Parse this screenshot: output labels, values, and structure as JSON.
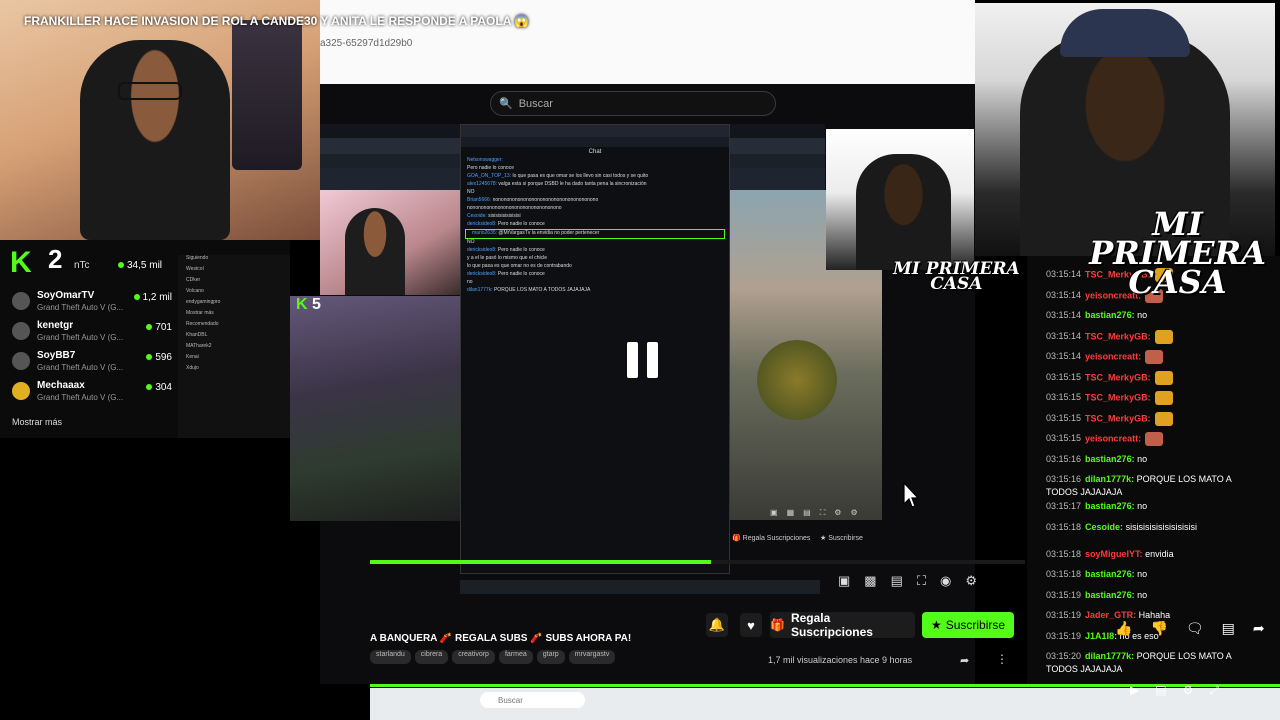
{
  "video": {
    "title": "FRANKILLER HACE INVASION DE ROL A CANDE30 Y ANITA LE RESPONDE A PAOLA 😱",
    "url_fragment": "a325-65297d1d29b0"
  },
  "search": {
    "placeholder": "Buscar"
  },
  "kick_panel": {
    "count": "2",
    "label": "nTc",
    "viewers": "34,5 mil",
    "streams": [
      {
        "name": "SoyOmarTV",
        "game": "Grand Theft Auto V (G...",
        "viewers": "1,2 mil"
      },
      {
        "name": "kenetgr",
        "game": "Grand Theft Auto V (G...",
        "viewers": "701"
      },
      {
        "name": "SoyBB7",
        "game": "Grand Theft Auto V (G...",
        "viewers": "596"
      },
      {
        "name": "Mechaaax",
        "game": "Grand Theft Auto V (G...",
        "viewers": "304"
      }
    ],
    "show_more": "Mostrar más",
    "following": [
      "Siguiendo",
      "Westcol",
      "CDker",
      "Volcano",
      "endygamingpro",
      "Mostrar más",
      "Recomendado",
      "KhanDBL",
      "MATharek2",
      "Kenai",
      "Xdujo"
    ],
    "badge_number": "5"
  },
  "chat_popup": {
    "header": "Chat",
    "lines": [
      {
        "user": "Nelsonswagger",
        "text": ""
      },
      {
        "user": "",
        "text": "Pero nadie lo conoce"
      },
      {
        "user": "GOA_ON_TOP_13",
        "text": "lo que pasa es que omar se los llevo sin casi todos y se quito"
      },
      {
        "user": "alex1245678",
        "text": "valga esta si porque DSBD le ha dado tanta pena la sincronización"
      },
      {
        "user": "",
        "text": "NO"
      },
      {
        "user": "Brian5666",
        "text": "nonononononononononononononononononono"
      },
      {
        "user": "",
        "text": "nonononononononononononononononono"
      },
      {
        "user": "Cesoide",
        "text": "sisisisisisisisisi"
      },
      {
        "user": "dericksideo8",
        "text": "Pero nadie lo conoce"
      },
      {
        "user": "mario2635",
        "text": "@MrVargasTv la envidia no poder pertenecer"
      },
      {
        "user": "",
        "text": "NO"
      },
      {
        "user": "dericksideo8",
        "text": "Pero nadie lo conoce"
      },
      {
        "user": "",
        "text": "y a el le pasó lo mismo que el chicle"
      },
      {
        "user": "",
        "text": "lo que pasa es que omar no es de contrabando"
      },
      {
        "user": "dericksideo8",
        "text": "Pero nadie lo conoce"
      },
      {
        "user": "",
        "text": "no"
      },
      {
        "user": "dilan1777k",
        "text": "PORQUE LOS MATO A TODOS JAJAJAJA"
      }
    ]
  },
  "right_chat": [
    {
      "time": "03:15:14",
      "user": "TSC_MerkyGB",
      "text": "",
      "color": "#ff3b3b",
      "emote": "#e0a020"
    },
    {
      "time": "03:15:14",
      "user": "yeisoncreatt",
      "text": "",
      "color": "#ff3b3b",
      "emote": "#c0604a"
    },
    {
      "time": "03:15:14",
      "user": "bastian276",
      "text": "no",
      "color": "#53fc18",
      "emote": ""
    },
    {
      "time": "03:15:14",
      "user": "TSC_MerkyGB",
      "text": "",
      "color": "#ff3b3b",
      "emote": "#e0a020"
    },
    {
      "time": "03:15:14",
      "user": "yeisoncreatt",
      "text": "",
      "color": "#ff3b3b",
      "emote": "#c0604a"
    },
    {
      "time": "03:15:15",
      "user": "TSC_MerkyGB",
      "text": "",
      "color": "#ff3b3b",
      "emote": "#e0a020"
    },
    {
      "time": "03:15:15",
      "user": "TSC_MerkyGB",
      "text": "",
      "color": "#ff3b3b",
      "emote": "#e0a020"
    },
    {
      "time": "03:15:15",
      "user": "TSC_MerkyGB",
      "text": "",
      "color": "#ff3b3b",
      "emote": "#e0a020"
    },
    {
      "time": "03:15:15",
      "user": "yeisoncreatt",
      "text": "",
      "color": "#ff3b3b",
      "emote": "#c0604a"
    },
    {
      "time": "03:15:16",
      "user": "bastian276",
      "text": "no",
      "color": "#53fc18",
      "emote": ""
    },
    {
      "time": "03:15:16",
      "user": "dilan1777k",
      "text": "PORQUE LOS MATO A TODOS JAJAJAJA",
      "color": "#53fc18",
      "emote": ""
    },
    {
      "time": "03:15:17",
      "user": "bastian276",
      "text": "no",
      "color": "#53fc18",
      "emote": ""
    },
    {
      "time": "03:15:18",
      "user": "Cesoide",
      "text": "sisisisisisisisisisisi",
      "color": "#53fc18",
      "emote": ""
    },
    {
      "time": "03:15:18",
      "user": "soyMiguelYT",
      "text": "envidia",
      "color": "#ff3b3b",
      "emote": ""
    },
    {
      "time": "03:15:18",
      "user": "bastian276",
      "text": "no",
      "color": "#53fc18",
      "emote": ""
    },
    {
      "time": "03:15:19",
      "user": "bastian276",
      "text": "no",
      "color": "#53fc18",
      "emote": ""
    },
    {
      "time": "03:15:19",
      "user": "Jader_GTR",
      "text": "Hahaha",
      "color": "#ff3b3b",
      "emote": ""
    },
    {
      "time": "03:15:19",
      "user": "J1A1I8",
      "text": "no es eso",
      "color": "#53fc18",
      "emote": ""
    },
    {
      "time": "03:15:20",
      "user": "dilan1777k",
      "text": "PORQUE LOS MATO A TODOS JAJAJAJA",
      "color": "#53fc18",
      "emote": ""
    }
  ],
  "actions": {
    "gift_label": "Regala Suscripciones",
    "subscribe_label": "Suscribirse",
    "gift_mini": "Regala Suscripciones",
    "sub_mini": "Suscribirse"
  },
  "banner": "A BANQUERA 🧨 REGALA SUBS 🧨 SUBS AHORA PA!",
  "tags": [
    "starlandu",
    "cibrera",
    "creativorp",
    "farmea",
    "gtarp",
    "mrvargastv"
  ],
  "views": "1,7 mil visualizaciones   hace 9 horas",
  "logo_text": [
    "MI PRIMERA",
    "CASA"
  ],
  "taskbar_search": "Buscar",
  "progress": {
    "stream_bar_fraction": 0.52
  },
  "colors": {
    "kick_green": "#53fc18",
    "dark_bg": "#0c0c0e"
  }
}
